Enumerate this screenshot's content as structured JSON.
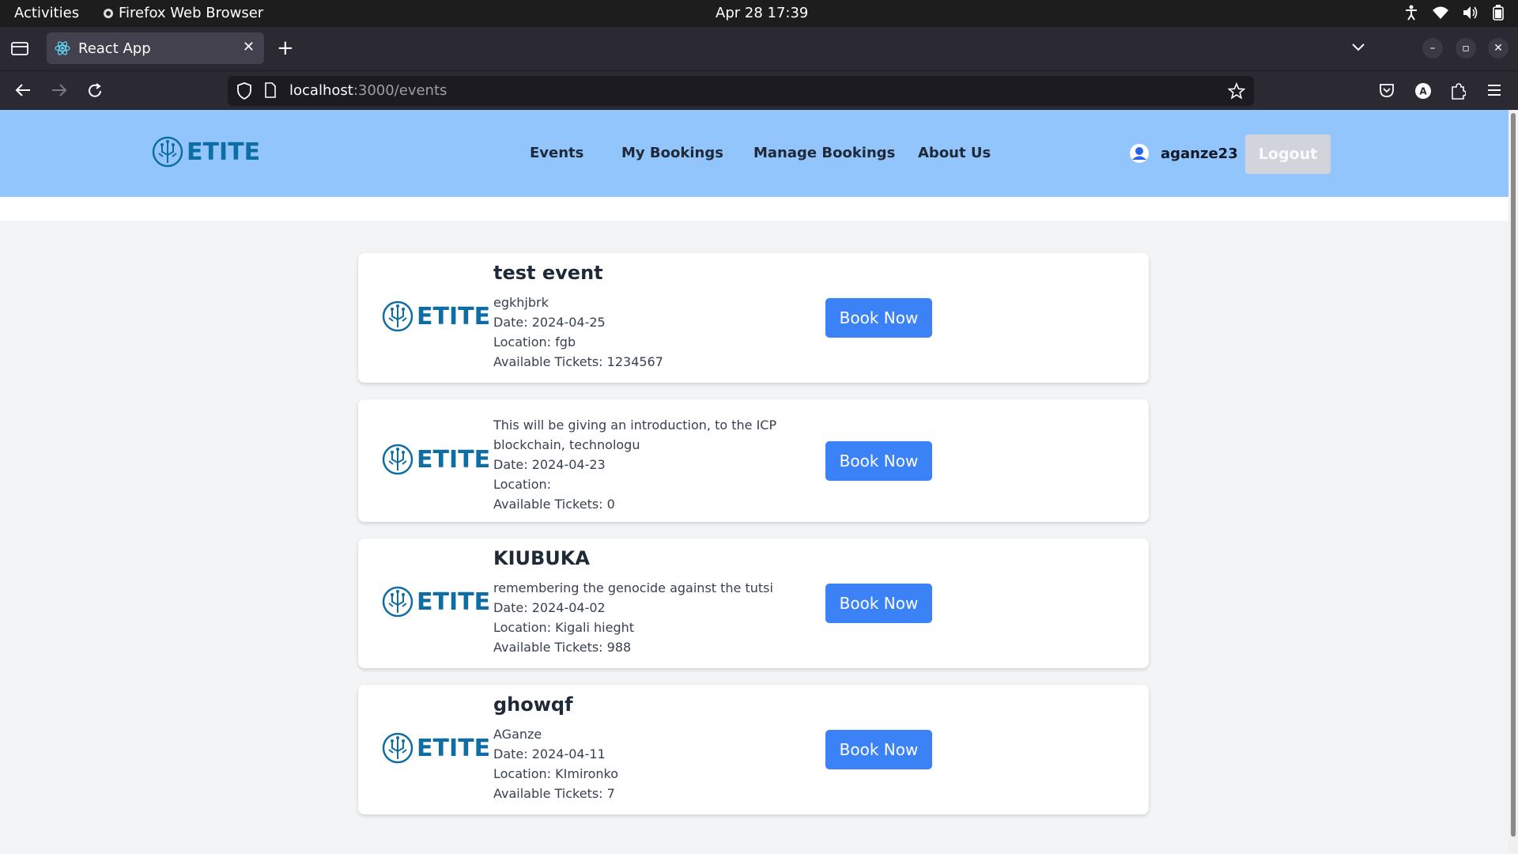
{
  "system_bar": {
    "activities": "Activities",
    "app_name": "Firefox Web Browser",
    "datetime": "Apr 28  17:39"
  },
  "browser": {
    "tab_title": "React App",
    "url_host": "localhost",
    "url_rest": ":3000/events"
  },
  "header": {
    "logo_text": "ETITE",
    "nav": [
      "Events",
      "My Bookings",
      "Manage Bookings",
      "About Us"
    ],
    "username": "aganze23",
    "logout_label": "Logout"
  },
  "events": [
    {
      "title": "test event",
      "description": "egkhjbrk",
      "date": "Date: 2024-04-25",
      "location": "Location: fgb",
      "tickets": "Available Tickets: 1234567",
      "button": "Book Now"
    },
    {
      "title": "",
      "description": "This will be giving an introduction, to the ICP blockchain, technologu",
      "date": "Date: 2024-04-23",
      "location": "Location:",
      "tickets": "Available Tickets: 0",
      "button": "Book Now"
    },
    {
      "title": "KIUBUKA",
      "description": "remembering the genocide against the tutsi",
      "date": "Date: 2024-04-02",
      "location": "Location: Kigali hieght",
      "tickets": "Available Tickets: 988",
      "button": "Book Now"
    },
    {
      "title": "ghowqf",
      "description": "AGanze",
      "date": "Date: 2024-04-11",
      "location": "Location: KImironko",
      "tickets": "Available Tickets: 7",
      "button": "Book Now"
    }
  ]
}
